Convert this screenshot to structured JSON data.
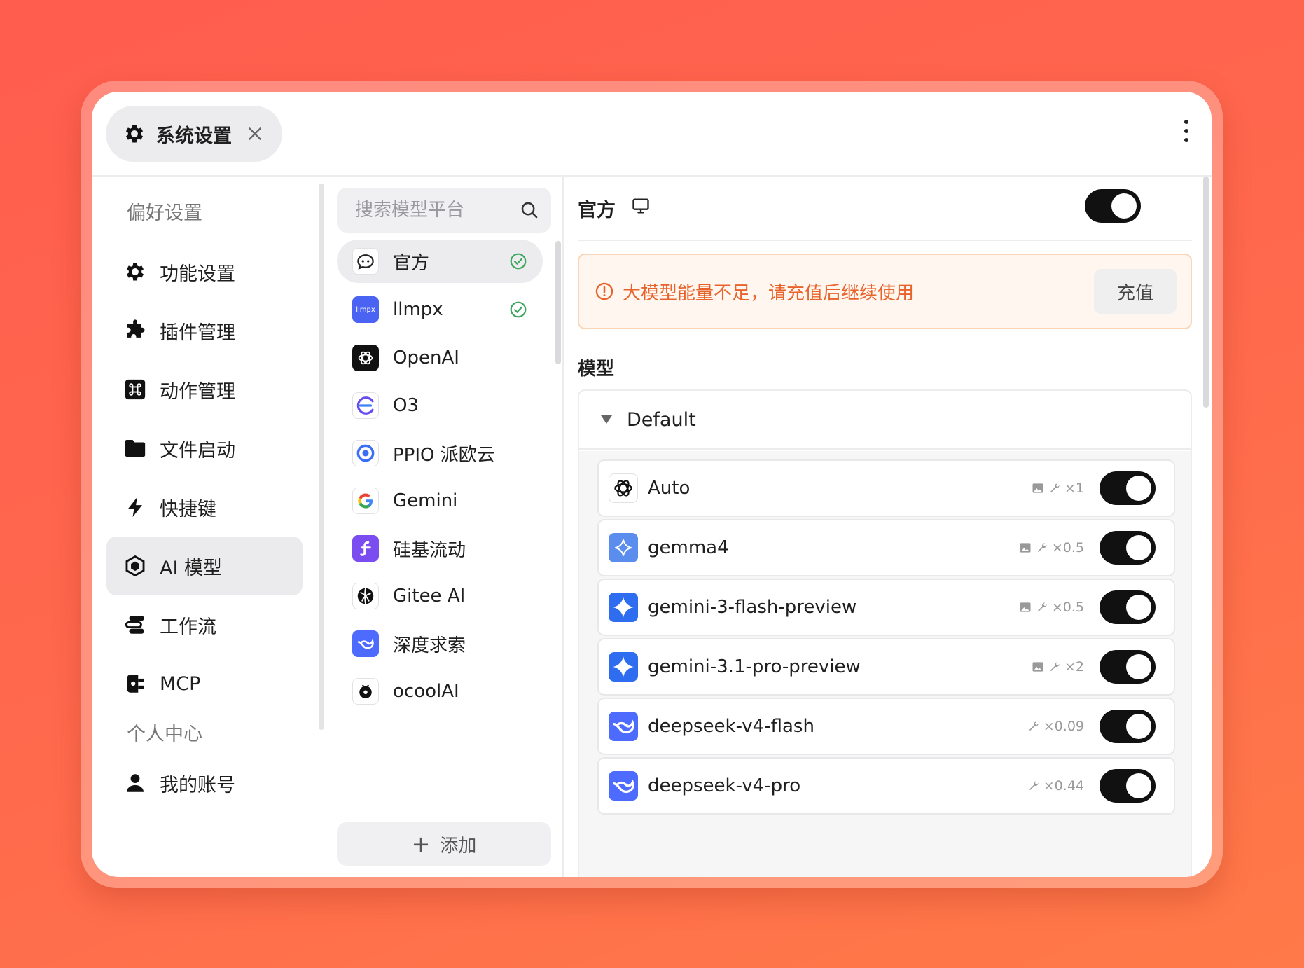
{
  "window": {
    "tab_title": "系统设置"
  },
  "sidebar": {
    "section_preferences": "偏好设置",
    "section_personal": "个人中心",
    "items": [
      {
        "label": "功能设置",
        "icon": "gear-icon"
      },
      {
        "label": "插件管理",
        "icon": "puzzle-icon"
      },
      {
        "label": "动作管理",
        "icon": "command-icon"
      },
      {
        "label": "文件启动",
        "icon": "folder-icon"
      },
      {
        "label": "快捷键",
        "icon": "lightning-icon"
      },
      {
        "label": "AI 模型",
        "icon": "cube-icon",
        "active": true
      },
      {
        "label": "工作流",
        "icon": "workflow-icon"
      },
      {
        "label": "MCP",
        "icon": "plug-icon"
      }
    ],
    "personal_items": [
      {
        "label": "我的账号",
        "icon": "user-icon"
      }
    ]
  },
  "providers": {
    "search_placeholder": "搜索模型平台",
    "items": [
      {
        "name": "官方",
        "checked": true,
        "active": true
      },
      {
        "name": "llmpx",
        "checked": true,
        "logo_text": "llmpx"
      },
      {
        "name": "OpenAI"
      },
      {
        "name": "O3"
      },
      {
        "name": "PPIO 派欧云"
      },
      {
        "name": "Gemini"
      },
      {
        "name": "硅基流动"
      },
      {
        "name": "Gitee AI"
      },
      {
        "name": "深度求索"
      },
      {
        "name": "ocoolAI"
      }
    ],
    "add_label": "添加",
    "add_icon": "plus-icon"
  },
  "main": {
    "title": "官方",
    "enabled": true,
    "alert_text": "大模型能量不足，请充值后继续使用",
    "alert_button": "充值",
    "models_label": "模型",
    "group_name": "Default",
    "models": [
      {
        "name": "Auto",
        "vision": true,
        "tools": true,
        "multiplier": "×1",
        "enabled": true,
        "logo": "openai-logo-icon"
      },
      {
        "name": "gemma4",
        "vision": true,
        "tools": true,
        "multiplier": "×0.5",
        "enabled": true,
        "logo": "gemma-logo-icon"
      },
      {
        "name": "gemini-3-flash-preview",
        "vision": true,
        "tools": true,
        "multiplier": "×0.5",
        "enabled": true,
        "logo": "gemini-logo-icon"
      },
      {
        "name": "gemini-3.1-pro-preview",
        "vision": true,
        "tools": true,
        "multiplier": "×2",
        "enabled": true,
        "logo": "gemini-logo-icon"
      },
      {
        "name": "deepseek-v4-flash",
        "vision": false,
        "tools": true,
        "multiplier": "×0.09",
        "enabled": true,
        "logo": "deepseek-logo-icon"
      },
      {
        "name": "deepseek-v4-pro",
        "vision": false,
        "tools": true,
        "multiplier": "×0.44",
        "enabled": true,
        "logo": "deepseek-logo-icon"
      }
    ]
  },
  "colors": {
    "accent_toggle": "#111111",
    "check_green": "#3aa55d",
    "alert_text": "#e8632b",
    "alert_bg": "#fff7ef",
    "background_gradient_start": "#ff5d4e",
    "background_gradient_end": "#ff7a48"
  }
}
